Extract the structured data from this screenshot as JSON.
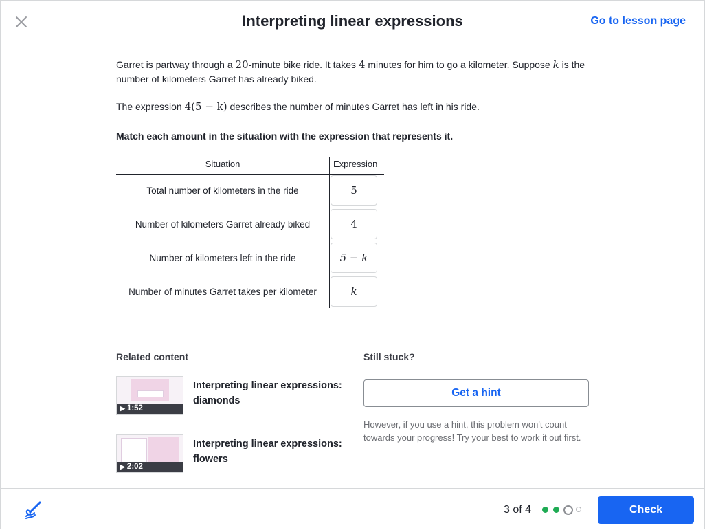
{
  "header": {
    "title": "Interpreting linear expressions",
    "lesson_link": "Go to lesson page"
  },
  "problem": {
    "p1_a": "Garret is partway through a ",
    "p1_math1": "20",
    "p1_b": "-minute bike ride. It takes ",
    "p1_math2": "4",
    "p1_c": " minutes for him to go a kilometer. Suppose ",
    "p1_var": "k",
    "p1_d": " is the number of kilometers Garret has already biked.",
    "p2_a": "The expression ",
    "p2_math": "4(5 − k)",
    "p2_b": " describes the number of minutes Garret has left in his ride.",
    "instruction": "Match each amount in the situation with the expression that represents it."
  },
  "matcher": {
    "col_situation": "Situation",
    "col_expression": "Expression",
    "rows": [
      {
        "situation": "Total number of kilometers in the ride",
        "expression": "5"
      },
      {
        "situation": "Number of kilometers Garret already biked",
        "expression": "4"
      },
      {
        "situation": "Number of kilometers left in the ride",
        "expression": "5 − k"
      },
      {
        "situation": "Number of minutes Garret takes per kilometer",
        "expression": "k"
      }
    ]
  },
  "related": {
    "heading": "Related content",
    "videos": [
      {
        "title": "Interpreting linear expressions: diamonds",
        "duration": "1:52"
      },
      {
        "title": "Interpreting linear expressions: flowers",
        "duration": "2:02"
      }
    ]
  },
  "stuck": {
    "heading": "Still stuck?",
    "hint_button": "Get a hint",
    "note": "However, if you use a hint, this problem won't count towards your progress! Try your best to work it out first."
  },
  "footer": {
    "progress": "3 of 4",
    "dots": [
      "complete",
      "complete",
      "current",
      "upcoming"
    ],
    "check_button": "Check"
  },
  "colors": {
    "accent": "#1865f2",
    "dot_complete": "#1fab54",
    "text": "#21242c"
  }
}
